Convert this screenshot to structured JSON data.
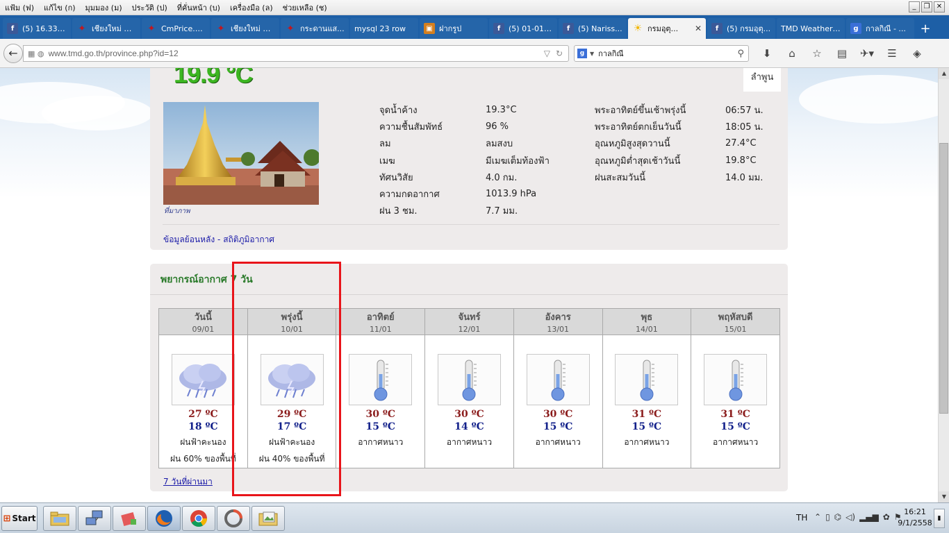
{
  "menubar": {
    "items": [
      "แฟ้ม (ฟ)",
      "แก้ไข (ก)",
      "มุมมอง (ม)",
      "ประวัติ (ป)",
      "ที่คั่นหน้า (บ)",
      "เครื่องมือ (ล)",
      "ช่วยเหลือ (ช)"
    ]
  },
  "tabs": [
    {
      "label": "(5) 16.33 ...",
      "icon": "facebook-icon"
    },
    {
      "label": "เชียงใหม่ ชุ...",
      "icon": "bird-icon"
    },
    {
      "label": "CmPrice.c...",
      "icon": "bird-icon"
    },
    {
      "label": "เชียงใหม่ ชุ...",
      "icon": "bird-icon"
    },
    {
      "label": "กระดานแส...",
      "icon": "bird-icon"
    },
    {
      "label": "mysql 23 row",
      "icon": ""
    },
    {
      "label": "ฝากรูป",
      "icon": "picture-icon"
    },
    {
      "label": "(5) 01-01-...",
      "icon": "facebook-icon"
    },
    {
      "label": "(5) Nariss...",
      "icon": "facebook-icon"
    },
    {
      "label": "กรมอุตุ...",
      "icon": "sun-icon"
    },
    {
      "label": "(5) กรมอุตุ...",
      "icon": "facebook-icon"
    },
    {
      "label": "TMD Weather ...",
      "icon": ""
    },
    {
      "label": "กาลกิณี - ...",
      "icon": "google-icon"
    }
  ],
  "navbar": {
    "url": "www.tmd.go.th/province.php?id=12",
    "search_value": "กาลกิณี"
  },
  "current": {
    "temperature": "19.9 °C",
    "province": "ลำพูน",
    "photo_credit": "ที่มาภาพ",
    "mid_stats": [
      {
        "label": "จุดน้ำค้าง",
        "value": "19.3°C"
      },
      {
        "label": "ความชื้นสัมพัทธ์",
        "value": "96 %"
      },
      {
        "label": "ลม",
        "value": "ลมสงบ"
      },
      {
        "label": "เมฆ",
        "value": "มีเมฆเต็มท้องฟ้า"
      },
      {
        "label": "ทัศนวิสัย",
        "value": "4.0 กม."
      },
      {
        "label": "ความกดอากาศ",
        "value": "1013.9 hPa"
      },
      {
        "label": "ฝน 3 ชม.",
        "value": "7.7 มม."
      }
    ],
    "right_stats": [
      {
        "label": "พระอาทิตย์ขึ้นเช้าพรุ่งนี้",
        "value": "06:57 น."
      },
      {
        "label": "พระอาทิตย์ตกเย็นวันนี้",
        "value": "18:05 น."
      },
      {
        "label": "อุณหภูมิสูงสุดวานนี้",
        "value": "27.4°C"
      },
      {
        "label": "อุณหภูมิต่ำสุดเช้าวันนี้",
        "value": "19.8°C"
      },
      {
        "label": "ฝนสะสมวันนี้",
        "value": "14.0 มม."
      }
    ],
    "history_link": "ข้อมูลย้อนหลัง - สถิติภูมิอากาศ"
  },
  "forecast": {
    "title": "พยากรณ์อากาศ 7 วัน",
    "days": [
      {
        "day": "วันนี้",
        "date": "09/01",
        "max": "27 ºC",
        "min": "18 ºC",
        "icon": "thunderstorm-icon",
        "condition": "ฝนฟ้าคะนอง",
        "rain": "ฝน 60% ของพื้นที่"
      },
      {
        "day": "พรุ่งนี้",
        "date": "10/01",
        "max": "29 ºC",
        "min": "17 ºC",
        "icon": "thunderstorm-icon",
        "condition": "ฝนฟ้าคะนอง",
        "rain": "ฝน 40% ของพื้นที่"
      },
      {
        "day": "อาทิตย์",
        "date": "11/01",
        "max": "30 ºC",
        "min": "15 ºC",
        "icon": "thermometer-icon",
        "condition": "อากาศหนาว",
        "rain": ""
      },
      {
        "day": "จันทร์",
        "date": "12/01",
        "max": "30 ºC",
        "min": "14 ºC",
        "icon": "thermometer-icon",
        "condition": "อากาศหนาว",
        "rain": ""
      },
      {
        "day": "อังคาร",
        "date": "13/01",
        "max": "30 ºC",
        "min": "15 ºC",
        "icon": "thermometer-icon",
        "condition": "อากาศหนาว",
        "rain": ""
      },
      {
        "day": "พุธ",
        "date": "14/01",
        "max": "31 ºC",
        "min": "15 ºC",
        "icon": "thermometer-icon",
        "condition": "อากาศหนาว",
        "rain": ""
      },
      {
        "day": "พฤหัสบดี",
        "date": "15/01",
        "max": "31 ºC",
        "min": "15 ºC",
        "icon": "thermometer-icon",
        "condition": "อากาศหนาว",
        "rain": ""
      }
    ],
    "past_link": "7 วันที่ผ่านมา"
  },
  "taskbar": {
    "start_label": "Start",
    "language": "TH",
    "time": "16:21",
    "date": "9/1/2558"
  },
  "colors": {
    "tab_strip": "#1d5fa6",
    "current_temp": "#3cb521",
    "max_temp": "#8b1c1c",
    "min_temp": "#12208a",
    "highlight": "#e8141a"
  }
}
